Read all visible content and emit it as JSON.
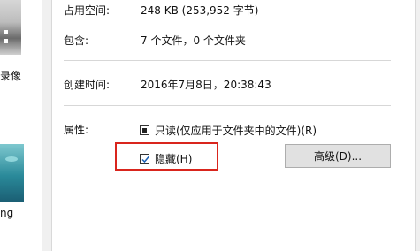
{
  "desktop": {
    "label_1": "录像",
    "label_2": "ng"
  },
  "properties": {
    "size_on_disk_label": "占用空间:",
    "size_on_disk_value": "248 KB (253,952 字节)",
    "contains_label": "包含:",
    "contains_value": "7 个文件，0 个文件夹",
    "created_label": "创建时间:",
    "created_value": "2016年7月8日，20:38:43",
    "attributes_label": "属性:",
    "readonly_label": "只读(仅应用于文件夹中的文件)(R)",
    "hidden_label": "隐藏(H)",
    "advanced_button": "高级(D)..."
  },
  "colors": {
    "highlight": "#d9251d",
    "checkmark": "#1a5fb4"
  }
}
